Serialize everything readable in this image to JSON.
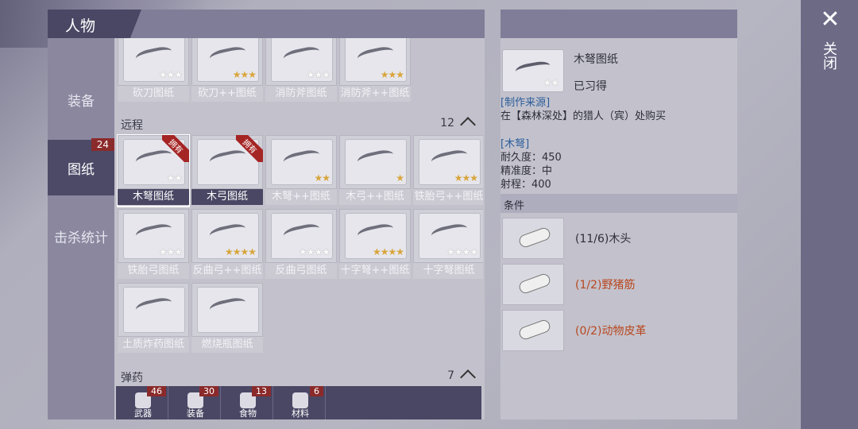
{
  "header": {
    "title": "人物"
  },
  "nav": [
    {
      "label": "装备",
      "badge": ""
    },
    {
      "label": "图纸",
      "badge": "24"
    },
    {
      "label": "击杀统计",
      "badge": ""
    }
  ],
  "top_row": [
    {
      "label": "砍刀图纸",
      "stars_on": 0,
      "stars": 3
    },
    {
      "label": "砍刀++图纸",
      "stars_on": 3,
      "stars": 3
    },
    {
      "label": "消防斧图纸",
      "stars_on": 0,
      "stars": 3
    },
    {
      "label": "消防斧++图纸",
      "stars_on": 3,
      "stars": 3
    }
  ],
  "ranged": {
    "label": "远程",
    "count": "12",
    "owned_tag": "拥有",
    "items": [
      {
        "label": "木弩图纸",
        "stars_on": 0,
        "stars": 2,
        "owned": true,
        "selected": true
      },
      {
        "label": "木弓图纸",
        "stars_on": 0,
        "stars": 0,
        "owned": true,
        "selected": false
      },
      {
        "label": "木弩++图纸",
        "stars_on": 2,
        "stars": 2,
        "owned": false,
        "selected": false
      },
      {
        "label": "木弓++图纸",
        "stars_on": 1,
        "stars": 1,
        "owned": false,
        "selected": false
      },
      {
        "label": "铁胎弓++图纸",
        "stars_on": 3,
        "stars": 3,
        "owned": false,
        "selected": false
      },
      {
        "label": "铁胎弓图纸",
        "stars_on": 0,
        "stars": 3,
        "owned": false,
        "selected": false
      },
      {
        "label": "反曲弓++图纸",
        "stars_on": 4,
        "stars": 4,
        "owned": false,
        "selected": false
      },
      {
        "label": "反曲弓图纸",
        "stars_on": 0,
        "stars": 4,
        "owned": false,
        "selected": false
      },
      {
        "label": "十字弩++图纸",
        "stars_on": 4,
        "stars": 4,
        "owned": false,
        "selected": false
      },
      {
        "label": "十字弩图纸",
        "stars_on": 0,
        "stars": 4,
        "owned": false,
        "selected": false
      },
      {
        "label": "土质炸药图纸",
        "stars_on": 0,
        "stars": 0,
        "owned": false,
        "selected": false
      },
      {
        "label": "燃烧瓶图纸",
        "stars_on": 0,
        "stars": 0,
        "owned": false,
        "selected": false
      }
    ]
  },
  "ammo": {
    "label": "弹药",
    "count": "7"
  },
  "bottom_tabs": [
    {
      "label": "武器",
      "badge": "46"
    },
    {
      "label": "装备",
      "badge": "30"
    },
    {
      "label": "食物",
      "badge": "13"
    },
    {
      "label": "材料",
      "badge": "6"
    }
  ],
  "detail": {
    "name": "木弩图纸",
    "learned": "已习得",
    "stars_on": 0,
    "stars": 2,
    "source_title": "[制作来源]",
    "source_text": "在【森林深处】的猎人（宾）处购买",
    "stat_title": "[木弩]",
    "stats": [
      "耐久度：450",
      "精准度：中",
      "射程：400"
    ],
    "cond_title": "条件",
    "conditions": [
      {
        "text": "(11/6)木头",
        "color": "#2e2e3a"
      },
      {
        "text": "(1/2)野猪筋",
        "color": "#b8471f"
      },
      {
        "text": "(0/2)动物皮革",
        "color": "#b8471f"
      }
    ]
  },
  "close": {
    "x": "✕",
    "label": "关闭"
  }
}
